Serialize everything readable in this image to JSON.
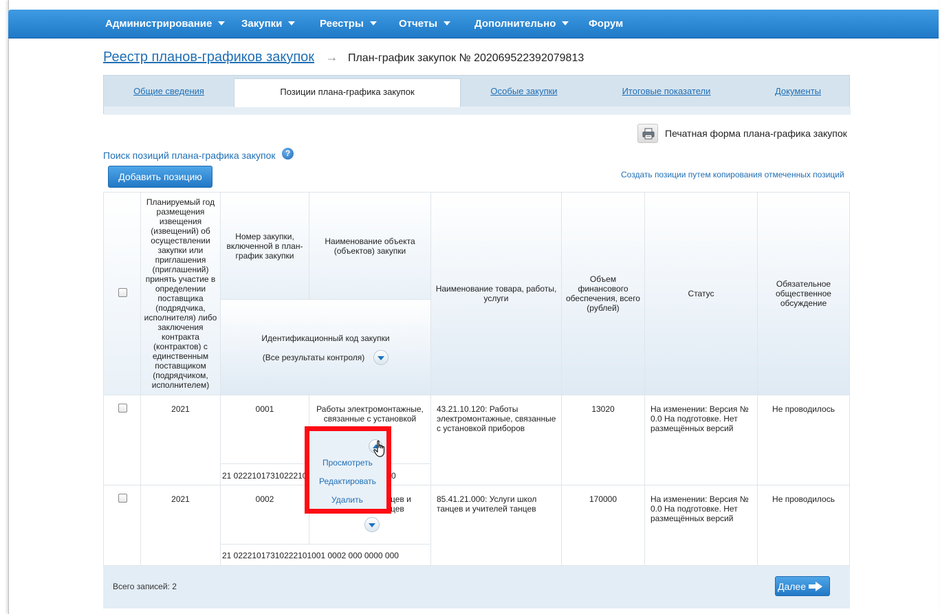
{
  "nav": {
    "items": [
      {
        "label": "Администрирование",
        "dropdown": true
      },
      {
        "label": "Закупки",
        "dropdown": true
      },
      {
        "label": "Реестры",
        "dropdown": true
      },
      {
        "label": "Отчеты",
        "dropdown": true
      },
      {
        "label": "Дополнительно",
        "dropdown": true
      },
      {
        "label": "Форум",
        "dropdown": false
      }
    ]
  },
  "breadcrumb": {
    "link": "Реестр планов-графиков закупок",
    "arrow": "→",
    "current": "План-график закупок № 202069522392079813"
  },
  "tabs": [
    {
      "label": "Общие сведения",
      "active": false
    },
    {
      "label": "Позиции плана-графика закупок",
      "active": true
    },
    {
      "label": "Особые закупки",
      "active": false
    },
    {
      "label": "Итоговые показатели",
      "active": false
    },
    {
      "label": "Документы",
      "active": false
    }
  ],
  "toolbar": {
    "print_label": "Печатная форма плана-графика закупок",
    "search_link": "Поиск позиций плана-графика закупок",
    "help": "?",
    "add_button": "Добавить позицию",
    "copy_link": "Создать позиции путем копирования отмеченных позиций"
  },
  "table": {
    "headers": {
      "year": "Планируемый год размещения извещения (извещений) об осуществлении закупки или приглашения (приглашений) принять участие в определении поставщика (подрядчика, исполнителя) либо заключения контракта (контрактов) с единственным поставщиком (подрядчиком, исполнителем)",
      "number": "Номер закупки, включенной в план-график закупки",
      "object": "Наименование объекта (объектов) закупки",
      "ikz": "Идентификационный код закупки",
      "ikz_filter": "(Все результаты контроля)",
      "goods": "Наименование товара, работы, услуги",
      "volume": "Объем финансового обеспечения, всего (рублей)",
      "status": "Статус",
      "discussion": "Обязательное общественное обсуждение"
    },
    "rows": [
      {
        "year": "2021",
        "number": "0001",
        "object": "Работы электромонтажные, связанные с установкой",
        "ikz_visible": "21 0222101731022210",
        "ikz_tail": "0",
        "goods": "43.21.10.120: Работы электромонтажные, связанные с установкой приборов",
        "volume": "13020",
        "status": "На изменении: Версия № 0.0 На подготовке. Нет размещённых версий",
        "discussion": "Не проводилось"
      },
      {
        "year": "2021",
        "number": "0002",
        "object_line1_tail": "цев и",
        "object_line2_tail": "цев",
        "ikz": "21 02221017310222101001 0002 000 0000 000",
        "goods": "85.41.21.000: Услуги школ танцев и учителей танцев",
        "volume": "170000",
        "status": "На изменении: Версия № 0.0 На подготовке. Нет размещённых версий",
        "discussion": "Не проводилось"
      }
    ]
  },
  "context_menu": {
    "items": [
      "Просмотреть",
      "Редактировать",
      "Удалить"
    ],
    "highlight_color": "#ff0a14"
  },
  "footer": {
    "count": "Всего записей: 2",
    "next_button": "Далее"
  }
}
